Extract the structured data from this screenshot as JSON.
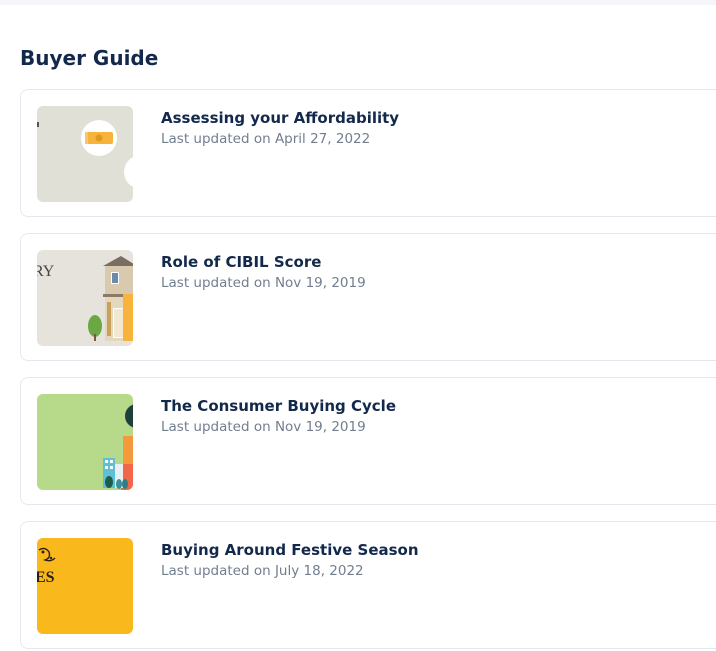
{
  "section": {
    "title": "Buyer Guide"
  },
  "articles": [
    {
      "title": "Assessing your Affordability",
      "meta": "Last updated on April 27, 2022",
      "thumb_icon": "money-coin-icon",
      "thumb_bg": "#e1e0d6"
    },
    {
      "title": "Role of CIBIL Score",
      "meta": "Last updated on Nov 19, 2019",
      "thumb_icon": "house-icon",
      "thumb_bg": "#e6e3dc",
      "thumb_text": "RY"
    },
    {
      "title": "The Consumer Buying Cycle",
      "meta": "Last updated on Nov 19, 2019",
      "thumb_icon": "city-buildings-icon",
      "thumb_bg": "#b6d98a"
    },
    {
      "title": "Buying Around Festive Season",
      "meta": "Last updated on July 18, 2022",
      "thumb_icon": "festive-lantern-icon",
      "thumb_bg": "#f9b91c",
      "thumb_text": "ES"
    }
  ]
}
